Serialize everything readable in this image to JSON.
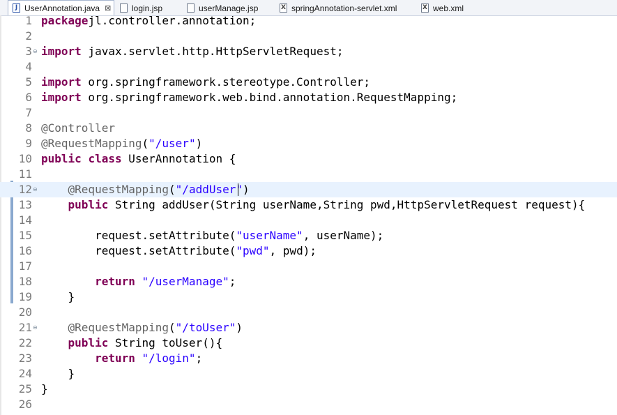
{
  "tabs": [
    {
      "label": "UserAnnotation.java",
      "icon": "java-file-icon",
      "glyph": "J",
      "active": true,
      "close": "⊠"
    },
    {
      "label": "login.jsp",
      "icon": "jsp-file-icon",
      "glyph": "",
      "active": false
    },
    {
      "label": "userManage.jsp",
      "icon": "jsp-file-icon",
      "glyph": "",
      "active": false
    },
    {
      "label": "springAnnotation-servlet.xml",
      "icon": "xml-file-icon",
      "glyph": "X",
      "active": false
    },
    {
      "label": "web.xml",
      "icon": "xml-file-icon",
      "glyph": "X",
      "active": false
    }
  ],
  "editor": {
    "current_line": 12,
    "lines": [
      {
        "n": "1",
        "fold": "",
        "tokens": [
          [
            "kw",
            "package"
          ],
          [
            "",
            "jl.controller.annotation;"
          ]
        ]
      },
      {
        "n": "2",
        "fold": "",
        "tokens": []
      },
      {
        "n": "3",
        "fold": "⊖",
        "tokens": [
          [
            "kw",
            "import"
          ],
          [
            "",
            " javax.servlet.http.HttpServletRequest;"
          ]
        ]
      },
      {
        "n": "4",
        "fold": "",
        "tokens": []
      },
      {
        "n": "5",
        "fold": "",
        "tokens": [
          [
            "kw",
            "import"
          ],
          [
            "",
            " org.springframework.stereotype.Controller;"
          ]
        ]
      },
      {
        "n": "6",
        "fold": "",
        "tokens": [
          [
            "kw",
            "import"
          ],
          [
            "",
            " org.springframework.web.bind.annotation.RequestMapping;"
          ]
        ]
      },
      {
        "n": "7",
        "fold": "",
        "tokens": []
      },
      {
        "n": "8",
        "fold": "",
        "tokens": [
          [
            "ann",
            "@Controller"
          ]
        ]
      },
      {
        "n": "9",
        "fold": "",
        "tokens": [
          [
            "ann",
            "@RequestMapping"
          ],
          [
            "",
            "("
          ],
          [
            "str",
            "\"/user\""
          ],
          [
            "",
            ")"
          ]
        ]
      },
      {
        "n": "10",
        "fold": "",
        "tokens": [
          [
            "kw",
            "public"
          ],
          [
            "",
            " "
          ],
          [
            "kw",
            "class"
          ],
          [
            "",
            " UserAnnotation {"
          ]
        ]
      },
      {
        "n": "11",
        "fold": "",
        "tokens": []
      },
      {
        "n": "12",
        "fold": "⊖",
        "tokens": [
          [
            "",
            "    "
          ],
          [
            "ann",
            "@RequestMapping"
          ],
          [
            "",
            "("
          ],
          [
            "str",
            "\"/addUser\""
          ],
          [
            "",
            ")"
          ]
        ]
      },
      {
        "n": "13",
        "fold": "",
        "tokens": [
          [
            "",
            "    "
          ],
          [
            "kw",
            "public"
          ],
          [
            "",
            " String addUser(String userName,String pwd,HttpServletRequest request){"
          ]
        ]
      },
      {
        "n": "14",
        "fold": "",
        "tokens": []
      },
      {
        "n": "15",
        "fold": "",
        "tokens": [
          [
            "",
            "        request.setAttribute("
          ],
          [
            "str",
            "\"userName\""
          ],
          [
            "",
            ", userName);"
          ]
        ]
      },
      {
        "n": "16",
        "fold": "",
        "tokens": [
          [
            "",
            "        request.setAttribute("
          ],
          [
            "str",
            "\"pwd\""
          ],
          [
            "",
            ", pwd);"
          ]
        ]
      },
      {
        "n": "17",
        "fold": "",
        "tokens": []
      },
      {
        "n": "18",
        "fold": "",
        "tokens": [
          [
            "",
            "        "
          ],
          [
            "kw",
            "return"
          ],
          [
            "",
            " "
          ],
          [
            "str",
            "\"/userManage\""
          ],
          [
            "",
            ";"
          ]
        ]
      },
      {
        "n": "19",
        "fold": "",
        "tokens": [
          [
            "",
            "    }"
          ]
        ]
      },
      {
        "n": "20",
        "fold": "",
        "tokens": []
      },
      {
        "n": "21",
        "fold": "⊖",
        "tokens": [
          [
            "",
            "    "
          ],
          [
            "ann",
            "@RequestMapping"
          ],
          [
            "",
            "("
          ],
          [
            "str",
            "\"/toUser\""
          ],
          [
            "",
            ")"
          ]
        ]
      },
      {
        "n": "22",
        "fold": "",
        "tokens": [
          [
            "",
            "    "
          ],
          [
            "kw",
            "public"
          ],
          [
            "",
            " String toUser(){"
          ]
        ]
      },
      {
        "n": "23",
        "fold": "",
        "tokens": [
          [
            "",
            "        "
          ],
          [
            "kw",
            "return"
          ],
          [
            "",
            " "
          ],
          [
            "str",
            "\"/login\""
          ],
          [
            "",
            ";"
          ]
        ]
      },
      {
        "n": "24",
        "fold": "",
        "tokens": [
          [
            "",
            "    }"
          ]
        ]
      },
      {
        "n": "25",
        "fold": "",
        "tokens": [
          [
            "",
            "}"
          ]
        ]
      },
      {
        "n": "26",
        "fold": "",
        "tokens": []
      }
    ]
  }
}
